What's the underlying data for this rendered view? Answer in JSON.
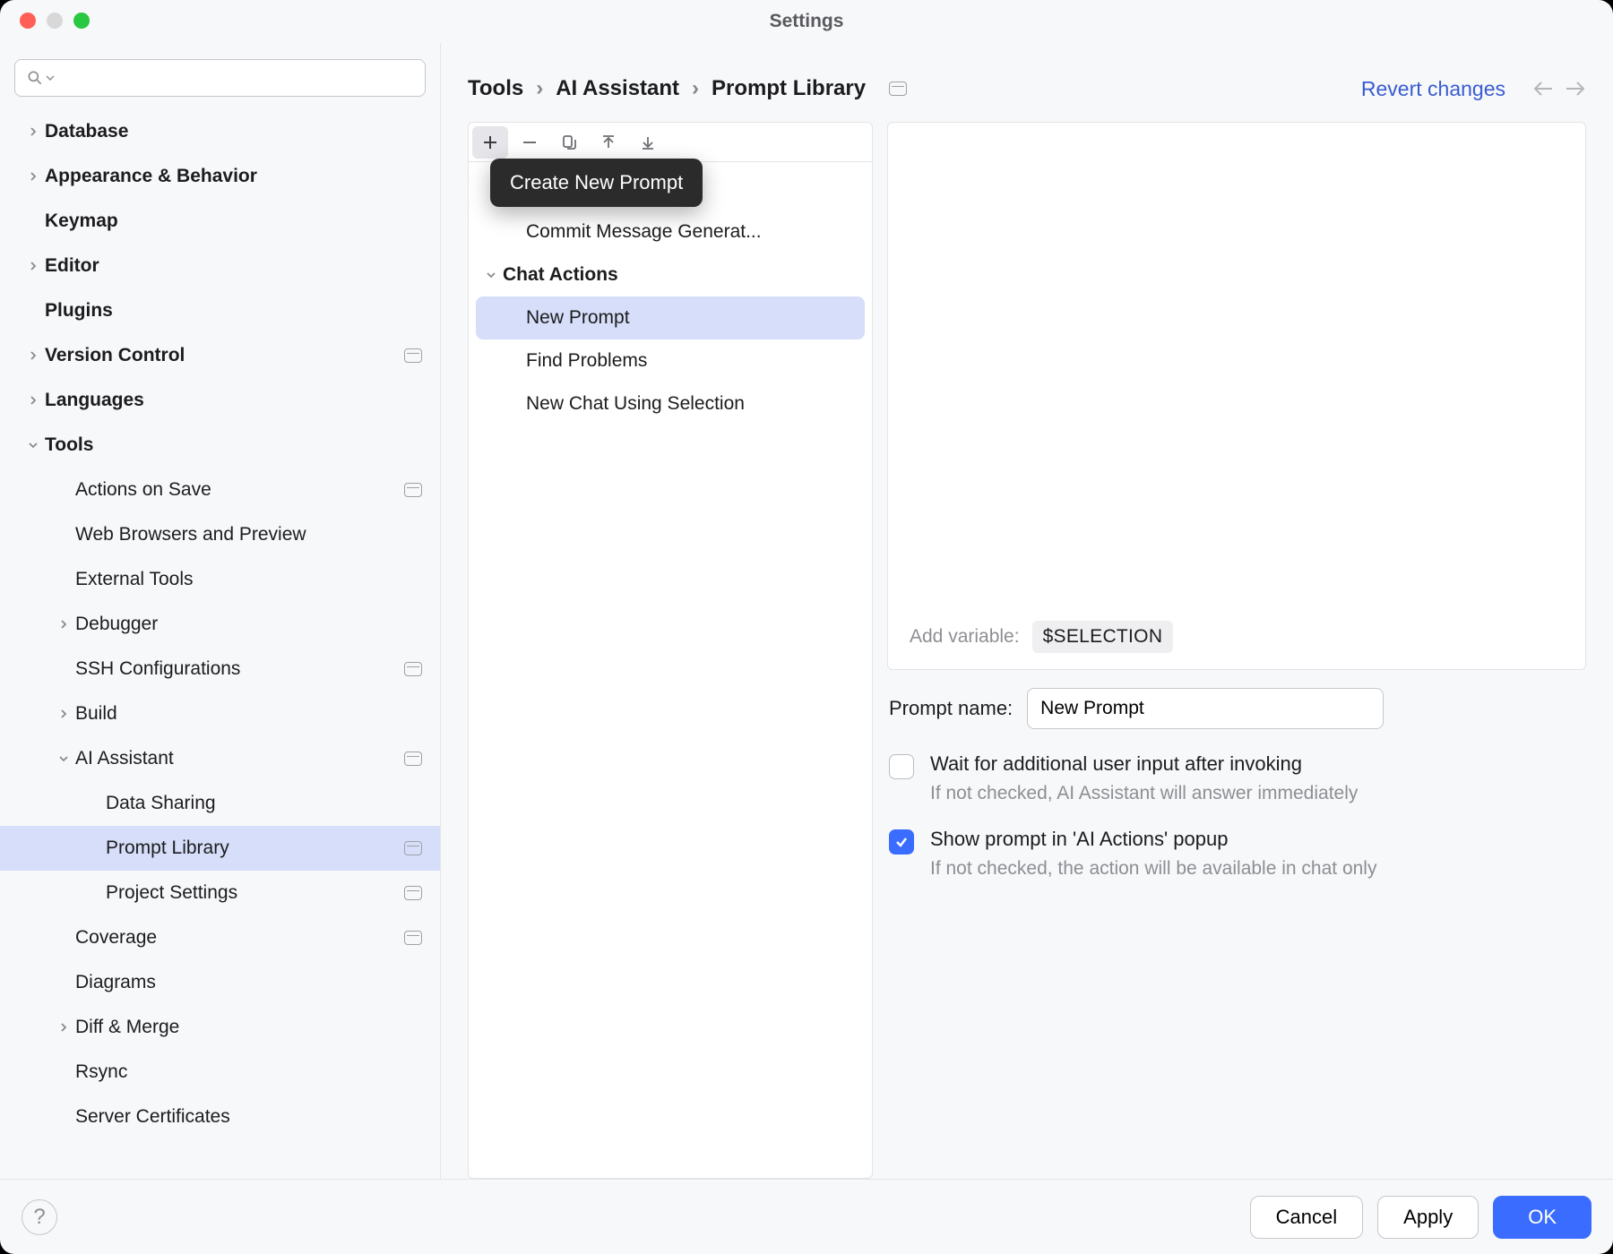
{
  "window": {
    "title": "Settings"
  },
  "sidebar": {
    "search_placeholder": "",
    "items": [
      {
        "label": "Database",
        "depth": 0,
        "arrow": "right",
        "bold": true
      },
      {
        "label": "Appearance & Behavior",
        "depth": 0,
        "arrow": "right",
        "bold": true
      },
      {
        "label": "Keymap",
        "depth": 0,
        "arrow": "none",
        "bold": true
      },
      {
        "label": "Editor",
        "depth": 0,
        "arrow": "right",
        "bold": true
      },
      {
        "label": "Plugins",
        "depth": 0,
        "arrow": "none",
        "bold": true
      },
      {
        "label": "Version Control",
        "depth": 0,
        "arrow": "right",
        "bold": true,
        "badge": true
      },
      {
        "label": "Languages",
        "depth": 0,
        "arrow": "right",
        "bold": true
      },
      {
        "label": "Tools",
        "depth": 0,
        "arrow": "down",
        "bold": true
      },
      {
        "label": "Actions on Save",
        "depth": 1,
        "arrow": "none",
        "badge": true
      },
      {
        "label": "Web Browsers and Preview",
        "depth": 1,
        "arrow": "none"
      },
      {
        "label": "External Tools",
        "depth": 1,
        "arrow": "none"
      },
      {
        "label": "Debugger",
        "depth": 1,
        "arrow": "right"
      },
      {
        "label": "SSH Configurations",
        "depth": 1,
        "arrow": "none",
        "badge": true
      },
      {
        "label": "Build",
        "depth": 1,
        "arrow": "right"
      },
      {
        "label": "AI Assistant",
        "depth": 1,
        "arrow": "down",
        "badge": true
      },
      {
        "label": "Data Sharing",
        "depth": 2,
        "arrow": "none"
      },
      {
        "label": "Prompt Library",
        "depth": 2,
        "arrow": "none",
        "badge": true,
        "selected": true
      },
      {
        "label": "Project Settings",
        "depth": 2,
        "arrow": "none",
        "badge": true
      },
      {
        "label": "Coverage",
        "depth": 1,
        "arrow": "none",
        "badge": true
      },
      {
        "label": "Diagrams",
        "depth": 1,
        "arrow": "none"
      },
      {
        "label": "Diff & Merge",
        "depth": 1,
        "arrow": "right"
      },
      {
        "label": "Rsync",
        "depth": 1,
        "arrow": "none"
      },
      {
        "label": "Server Certificates",
        "depth": 1,
        "arrow": "none"
      }
    ]
  },
  "breadcrumb": {
    "parts": [
      "Tools",
      "AI Assistant",
      "Prompt Library"
    ],
    "revert_label": "Revert changes"
  },
  "prompt_toolbar": {
    "tooltip": "Create New Prompt"
  },
  "prompt_tree": {
    "items": [
      {
        "label": "Commit Message Generat...",
        "type": "leaf"
      },
      {
        "label": "Chat Actions",
        "type": "group",
        "arrow": "down"
      },
      {
        "label": "New Prompt",
        "type": "leaf",
        "selected": true
      },
      {
        "label": "Find Problems",
        "type": "leaf"
      },
      {
        "label": "New Chat Using Selection",
        "type": "leaf"
      }
    ]
  },
  "editor": {
    "add_variable_label": "Add variable:",
    "variable_chip": "$SELECTION",
    "prompt_name_label": "Prompt name:",
    "prompt_name_value": "New Prompt",
    "wait_checkbox": {
      "checked": false,
      "title": "Wait for additional user input after invoking",
      "sub": "If not checked, AI Assistant will answer immediately"
    },
    "show_checkbox": {
      "checked": true,
      "title": "Show prompt in 'AI Actions' popup",
      "sub": "If not checked, the action will be available in chat only"
    }
  },
  "footer": {
    "cancel": "Cancel",
    "apply": "Apply",
    "ok": "OK"
  }
}
